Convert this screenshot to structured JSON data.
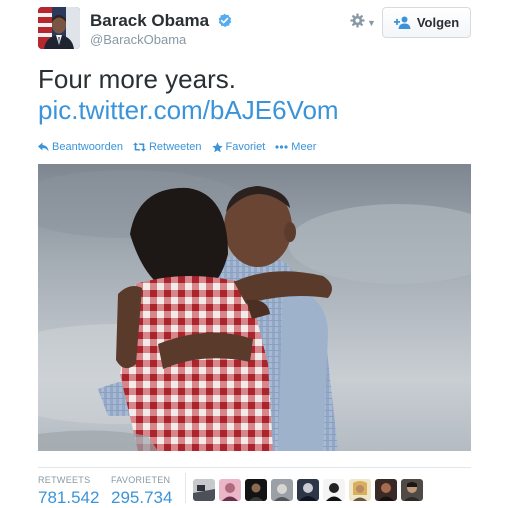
{
  "user": {
    "name": "Barack Obama",
    "handle": "@BarackObama",
    "verified": true
  },
  "header": {
    "follow_label": "Volgen"
  },
  "tweet": {
    "text": "Four more years.",
    "link": "pic.twitter.com/bAJE6Vom"
  },
  "actions": [
    {
      "label": "Beantwoorden",
      "icon": "reply-icon"
    },
    {
      "label": "Retweeten",
      "icon": "retweet-icon"
    },
    {
      "label": "Favoriet",
      "icon": "star-icon"
    },
    {
      "label": "Meer",
      "icon": "more-dots-icon"
    }
  ],
  "stats": {
    "retweets_label": "RETWEETS",
    "retweets_value": "781.542",
    "favorites_label": "FAVORIETEN",
    "favorites_value": "295.734"
  },
  "favorited_by_count": 9,
  "colors": {
    "link_blue": "#3b94d9",
    "text": "#292f33",
    "muted": "#8899a6",
    "verified": "#55acee"
  }
}
